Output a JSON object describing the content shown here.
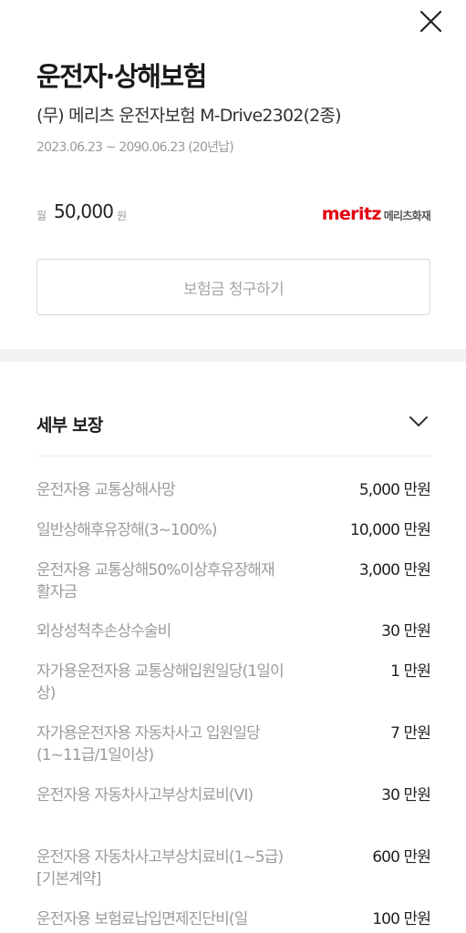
{
  "header": {
    "title": "운전자·상해보험",
    "subtitle": "(무) 메리츠 운전자보험 M-Drive2302(2종)",
    "period": "2023.06.23 ~ 2090.06.23 (20년납)"
  },
  "premium": {
    "prefix": "월",
    "amount": "50,000",
    "unit": "원"
  },
  "insurer": {
    "logo_en": "meritz",
    "logo_ko": "메리츠화재",
    "brand_color": "#e3000f"
  },
  "actions": {
    "claim_label": "보험금 청구하기"
  },
  "coverage": {
    "title": "세부 보장",
    "items": [
      {
        "name": "운전자용 교통상해사망",
        "amount": "5,000 만원"
      },
      {
        "name": "일반상해후유장해(3~100%)",
        "amount": "10,000 만원"
      },
      {
        "name": "운전자용 교통상해50%이상후유장해재활자금",
        "amount": "3,000 만원"
      },
      {
        "name": "외상성척추손상수술비",
        "amount": "30 만원"
      },
      {
        "name": "자가용운전자용 교통상해입원일당(1일이상)",
        "amount": "1 만원"
      },
      {
        "name": "자가용운전자용 자동차사고 입원일당(1~11급/1일이상)",
        "amount": "7 만원"
      },
      {
        "name": "운전자용 자동차사고부상치료비(VI)",
        "amount": "30 만원"
      },
      {
        "name": "운전자용 자동차사고부상치료비(1~5급)[기본계약]",
        "amount": "600 만원"
      },
      {
        "name": "운전자용 보험료납입면제진단비(일",
        "amount": "100 만원"
      }
    ]
  },
  "icons": {
    "close": "close-icon",
    "chevron": "chevron-down-icon"
  }
}
